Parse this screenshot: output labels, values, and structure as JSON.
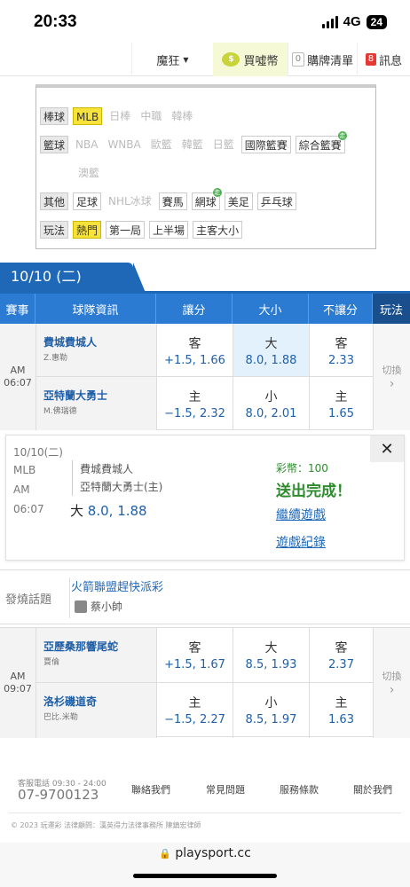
{
  "status": {
    "time": "20:33",
    "network": "4G",
    "battery": "24"
  },
  "nav": {
    "user": "魔狂",
    "coins": "買噓幣",
    "cart_count": "0",
    "cart": "購牌清單",
    "msg_count": "8",
    "msg": "訊息"
  },
  "filter": {
    "baseball": {
      "label": "棒球",
      "items": [
        "MLB",
        "日棒",
        "中職",
        "韓棒"
      ]
    },
    "basketball": {
      "label": "籃球",
      "items": [
        "NBA",
        "WNBA",
        "歐籃",
        "韓籃",
        "日籃",
        "國際籃賽",
        "綜合籃賽",
        "澳籃"
      ]
    },
    "other": {
      "label": "其他",
      "items": [
        "足球",
        "NHL冰球",
        "賽馬",
        "網球",
        "美足",
        "乒乓球"
      ]
    },
    "play": {
      "label": "玩法",
      "items": [
        "熱門",
        "第一局",
        "上半場",
        "主客大小"
      ]
    },
    "tag": "走"
  },
  "date": "10/10 (二)",
  "table": {
    "headers": [
      "賽事",
      "球隊資訊",
      "讓分",
      "大小",
      "不讓分",
      "玩法"
    ]
  },
  "matches": [
    {
      "period": "AM",
      "time": "06:07",
      "switch": "切換",
      "away": {
        "team": "費城費城人",
        "pitcher": "Z.惠勒",
        "spread_side": "客",
        "spread": "+1.5, 1.66",
        "ou_side": "大",
        "ou": "8.0, 1.88",
        "ml_side": "客",
        "ml": "2.33"
      },
      "home": {
        "team": "亞特蘭大勇士",
        "pitcher": "M.佛瑞德",
        "spread_side": "主",
        "spread": "−1.5, 2.32",
        "ou_side": "小",
        "ou": "8.0, 2.01",
        "ml_side": "主",
        "ml": "1.65"
      }
    },
    {
      "period": "AM",
      "time": "09:07",
      "switch": "切換",
      "away": {
        "team": "亞歷桑那響尾蛇",
        "pitcher": "賈倫",
        "spread_side": "客",
        "spread": "+1.5, 1.67",
        "ou_side": "大",
        "ou": "8.5, 1.93",
        "ml_side": "客",
        "ml": "2.37"
      },
      "home": {
        "team": "洛杉磯道奇",
        "pitcher": "巴比.米勒",
        "spread_side": "主",
        "spread": "−1.5, 2.27",
        "ou_side": "小",
        "ou": "8.5, 1.97",
        "ml_side": "主",
        "ml": "1.63"
      }
    }
  ],
  "popup": {
    "date": "10/10(二)",
    "league": "MLB",
    "period": "AM",
    "time": "06:07",
    "team_away": "費城費城人",
    "team_home": "亞特蘭大勇士(主)",
    "bet_side": "大",
    "bet_value": "8.0, 1.88",
    "coins": "彩幣：100",
    "done": "送出完成！",
    "continue": "繼續遊戲",
    "record": "遊戲紀錄",
    "close": "✕"
  },
  "hot": {
    "label": "發燒話題",
    "title": "火箭聯盟趕快派彩",
    "author": "蔡小帥"
  },
  "footer": {
    "phone_label": "客服電話 09:30 - 24:00",
    "phone": "07-9700123",
    "links": [
      "聯絡我們",
      "常見問題",
      "服務條款",
      "關於我們"
    ],
    "copyright": "© 2023 玩運彩  法律顧問：漢英得力法律事務所 陳鎮宏律師"
  },
  "url": "playsport.cc"
}
